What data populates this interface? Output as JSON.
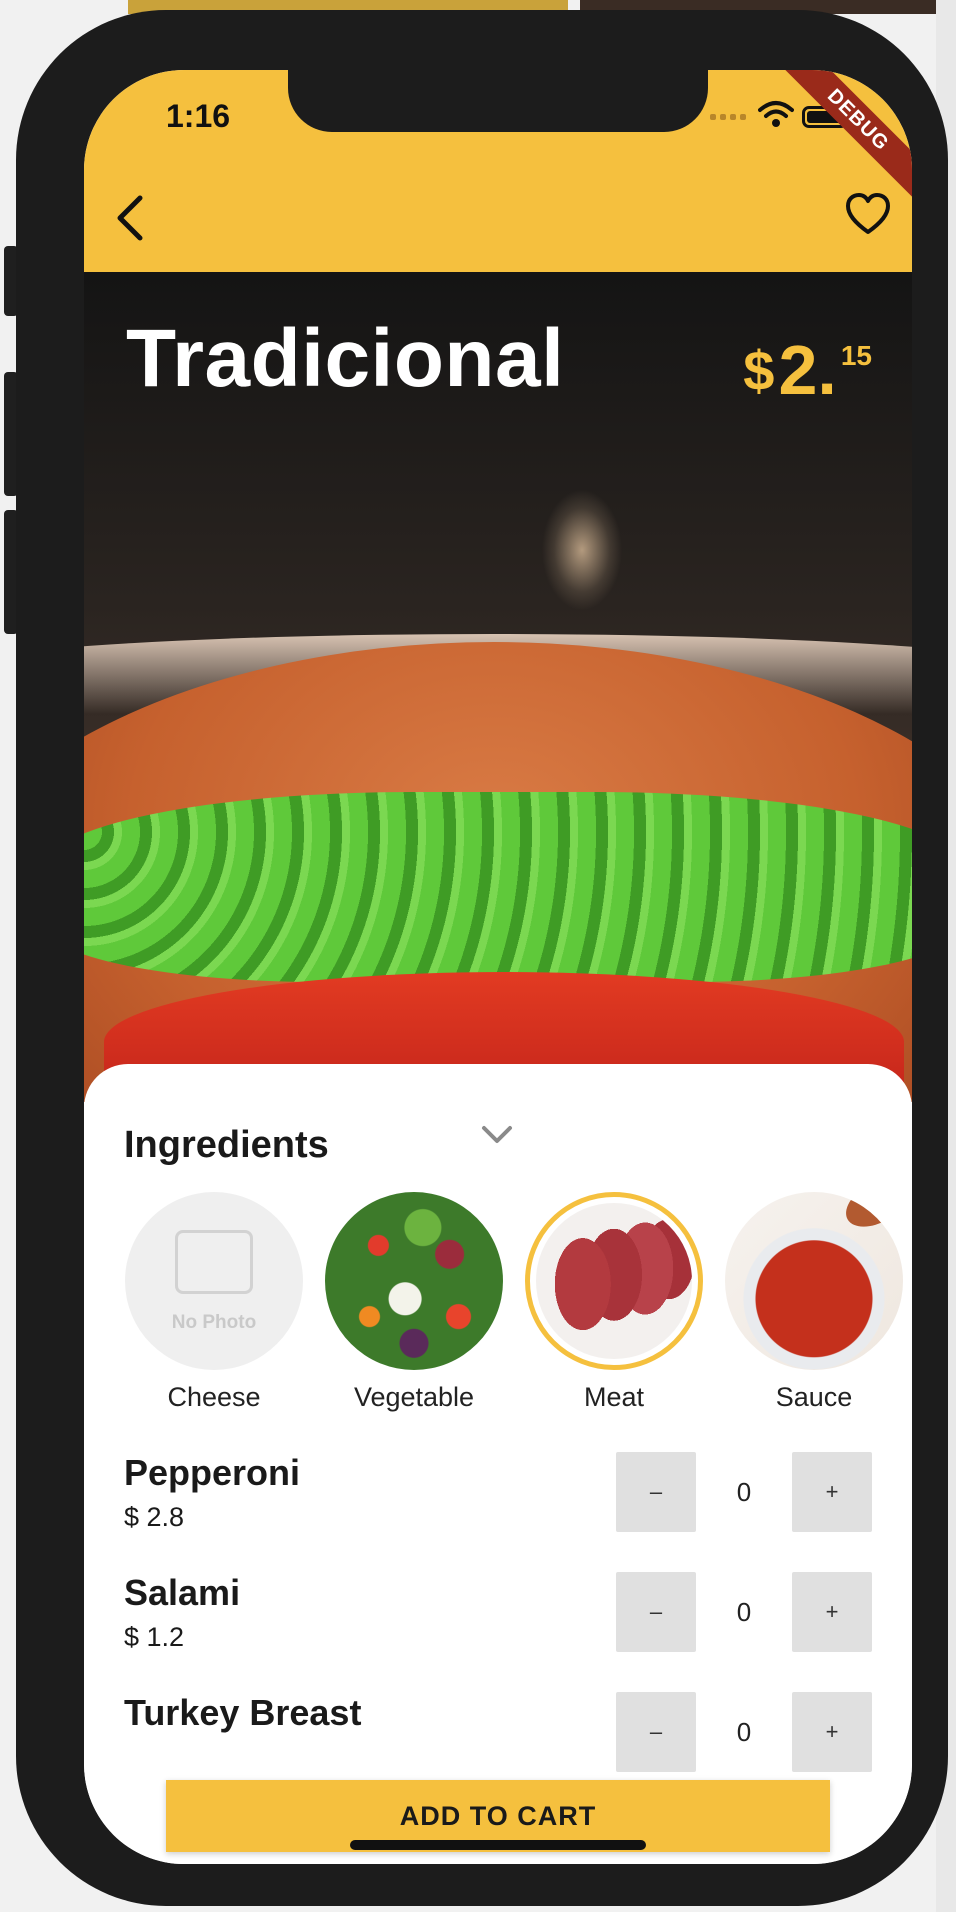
{
  "status_bar": {
    "time": "1:16",
    "debug_label": "DEBUG"
  },
  "header": {
    "back_icon": "chevron-left-icon",
    "favorite_icon": "heart-icon",
    "background_color": "#f5c03e"
  },
  "product": {
    "name": "Tradicional",
    "price_currency": "$",
    "price_main": "2.",
    "price_cents": "15",
    "image": "burger-photo"
  },
  "ingredients": {
    "title": "Ingredients",
    "categories": [
      {
        "label": "Cheese",
        "image": "no-photo",
        "placeholder_text": "No Photo",
        "selected": false
      },
      {
        "label": "Vegetable",
        "image": "vegetables-photo",
        "selected": false
      },
      {
        "label": "Meat",
        "image": "meat-photo",
        "selected": true
      },
      {
        "label": "Sauce",
        "image": "sauce-photo",
        "selected": false
      }
    ]
  },
  "items": [
    {
      "name": "Pepperoni",
      "price": "$ 2.8",
      "quantity": "0",
      "minus_label": "–",
      "plus_label": "+"
    },
    {
      "name": "Salami",
      "price": "$ 1.2",
      "quantity": "0",
      "minus_label": "–",
      "plus_label": "+"
    },
    {
      "name": "Turkey Breast",
      "price": "",
      "quantity": "0",
      "minus_label": "–",
      "plus_label": "+"
    }
  ],
  "cart_button": {
    "label": "ADD TO CART"
  },
  "colors": {
    "accent": "#f5c03e",
    "selected_border": "#f5c03e",
    "stepper_bg": "#e0e0e0"
  }
}
